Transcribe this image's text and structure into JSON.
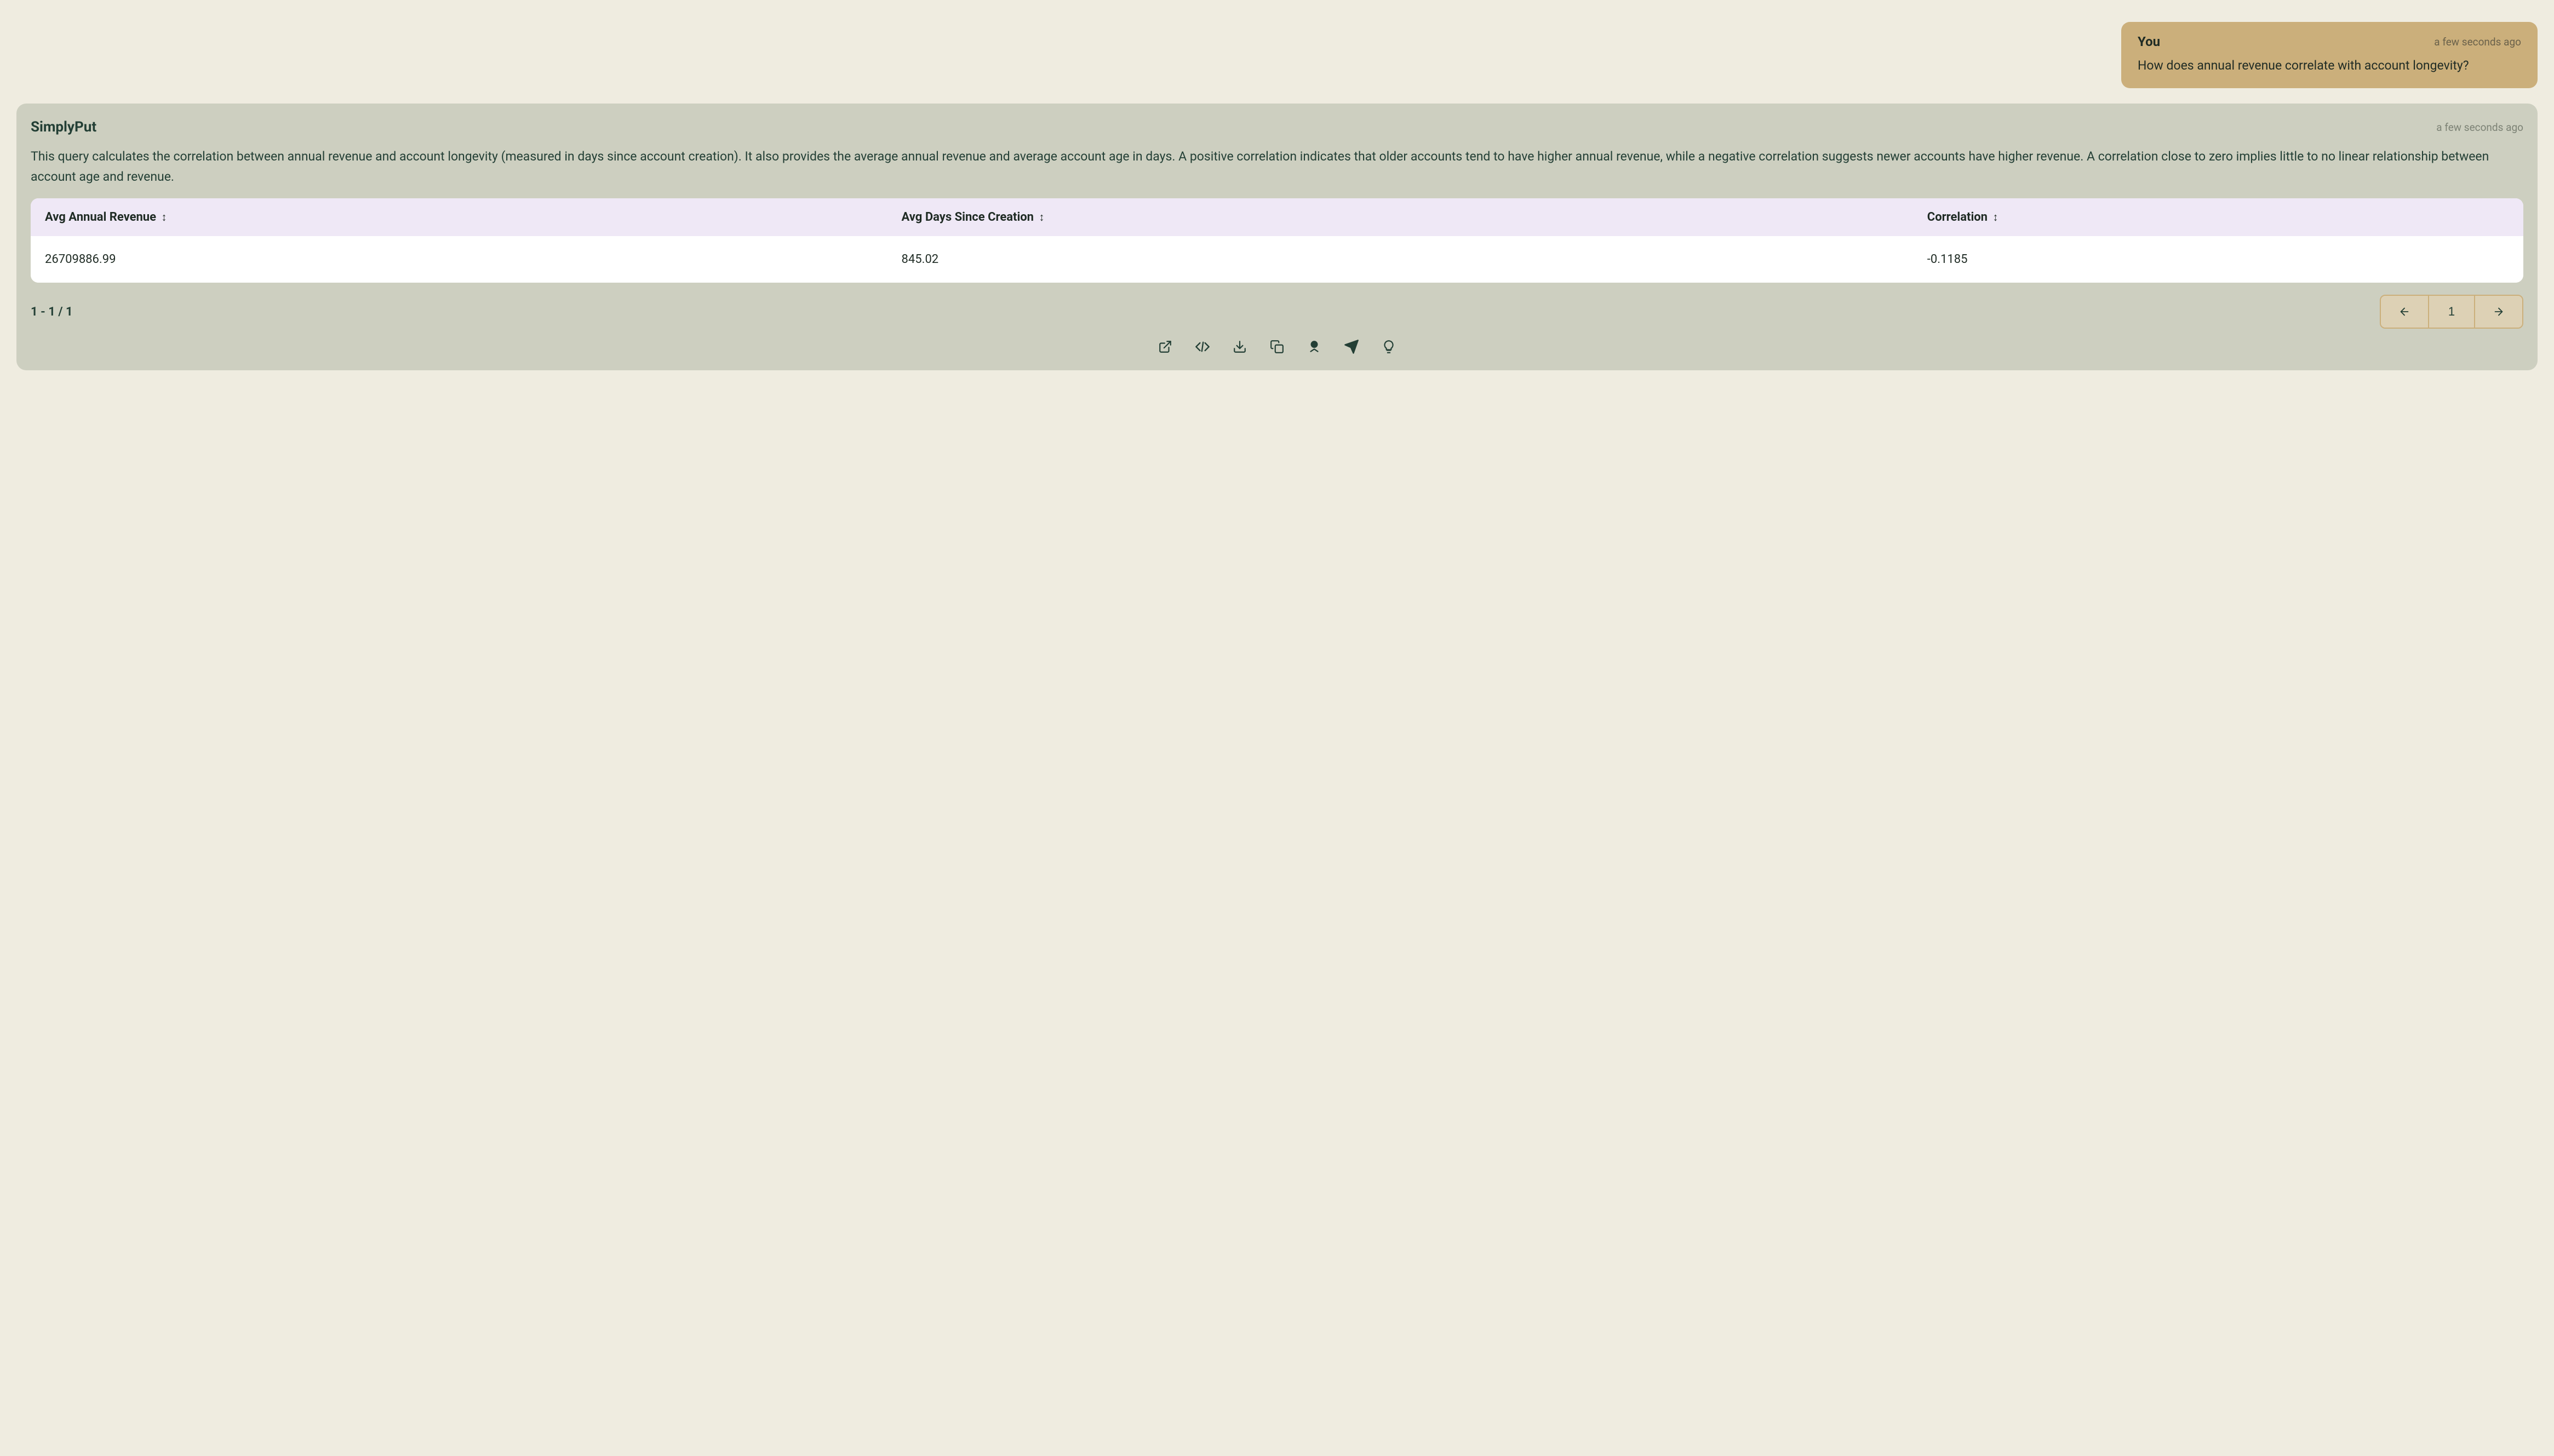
{
  "user_message": {
    "sender": "You",
    "timestamp": "a few seconds ago",
    "text": "How does annual revenue correlate with account longevity?"
  },
  "assistant_message": {
    "sender": "SimplyPut",
    "timestamp": "a few seconds ago",
    "body": "This query calculates the correlation between annual revenue and account longevity (measured in days since account creation). It also provides the average annual revenue and average account age in days. A positive correlation indicates that older accounts tend to have higher annual revenue, while a negative correlation suggests newer accounts have higher revenue. A correlation close to zero implies little to no linear relationship between account age and revenue."
  },
  "table": {
    "columns": [
      "Avg Annual Revenue",
      "Avg Days Since Creation",
      "Correlation"
    ],
    "rows": [
      {
        "c0": "26709886.99",
        "c1": "845.02",
        "c2": "-0.1185"
      }
    ]
  },
  "pagination": {
    "range_text": "1 - 1 / 1",
    "current_page": "1"
  },
  "actions": {
    "open": "open-external",
    "code": "view-code",
    "download": "download",
    "copy": "copy",
    "award": "award",
    "send": "send",
    "idea": "idea"
  }
}
